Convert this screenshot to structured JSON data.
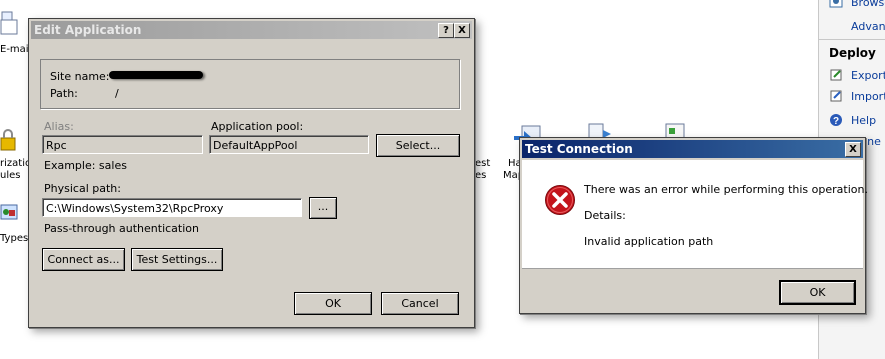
{
  "background": {
    "left_labels": {
      "email": "E-mai",
      "authorization_1": "rizatio",
      "authorization_2": "ules",
      "types": "Types"
    },
    "mid_labels": {
      "test_1": "est",
      "test_2": "es",
      "handler_1": "Ha",
      "handler_2": "Map"
    },
    "right_pane": {
      "browse": "Browse",
      "advanced": "Advan",
      "deploy_heading": "Deploy",
      "export": "Export",
      "import": "Import",
      "help": "Help",
      "online": "line"
    }
  },
  "edit_application": {
    "title": "Edit Application",
    "help_button": "?",
    "close_button": "X",
    "site_name_label": "Site name:",
    "path_label": "Path:",
    "path_value": "/",
    "alias_label": "Alias:",
    "alias_value": "Rpc",
    "app_pool_label": "Application pool:",
    "app_pool_value": "DefaultAppPool",
    "select_button": "Select...",
    "example_text": "Example: sales",
    "physical_path_label": "Physical path:",
    "physical_path_value": "C:\\Windows\\System32\\RpcProxy",
    "browse_button": "...",
    "pass_through_label": "Pass-through authentication",
    "connect_as_button": "Connect as...",
    "test_settings_button": "Test Settings...",
    "ok_button": "OK",
    "cancel_button": "Cancel"
  },
  "test_connection": {
    "title": "Test Connection",
    "close_button": "X",
    "message": "There was an error while performing this operation.",
    "details_label": "Details:",
    "details_value": "Invalid application path",
    "ok_button": "OK",
    "icon": "error-icon"
  },
  "colors": {
    "dialog_bg": "#d4d0c8",
    "active_title": "#0a246a",
    "inactive_title": "#9b9b9b",
    "error_red": "#c4141b"
  }
}
